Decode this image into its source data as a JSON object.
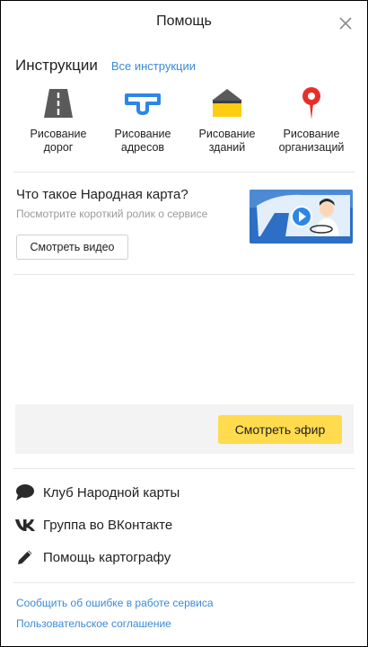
{
  "header": {
    "title": "Помощь"
  },
  "instructions": {
    "title": "Инструкции",
    "all_link": "Все инструкции",
    "items": [
      {
        "line1": "Рисование",
        "line2": "дорог",
        "icon": "road-icon"
      },
      {
        "line1": "Рисование",
        "line2": "адресов",
        "icon": "address-icon"
      },
      {
        "line1": "Рисование",
        "line2": "зданий",
        "icon": "building-icon"
      },
      {
        "line1": "Рисование",
        "line2": "организаций",
        "icon": "map-pin-icon"
      }
    ]
  },
  "promo": {
    "title": "Что такое Народная карта?",
    "subtitle": "Посмотрите короткий ролик о сервисе",
    "button": "Смотреть видео"
  },
  "live": {
    "button": "Смотреть эфир"
  },
  "links": [
    {
      "label": "Клуб Народной карты",
      "icon": "chat-bubble-icon"
    },
    {
      "label": "Группа во ВКонтакте",
      "icon": "vk-icon"
    },
    {
      "label": "Помощь картографу",
      "icon": "pencil-icon"
    }
  ],
  "footer": {
    "report": "Сообщить об ошибке в работе сервиса",
    "agreement": "Пользовательское соглашение"
  },
  "colors": {
    "accent": "#ffdb4d",
    "link": "#3a8bd9",
    "pin": "#e5302a",
    "address": "#2b87e6",
    "road": "#5a5a5a"
  }
}
